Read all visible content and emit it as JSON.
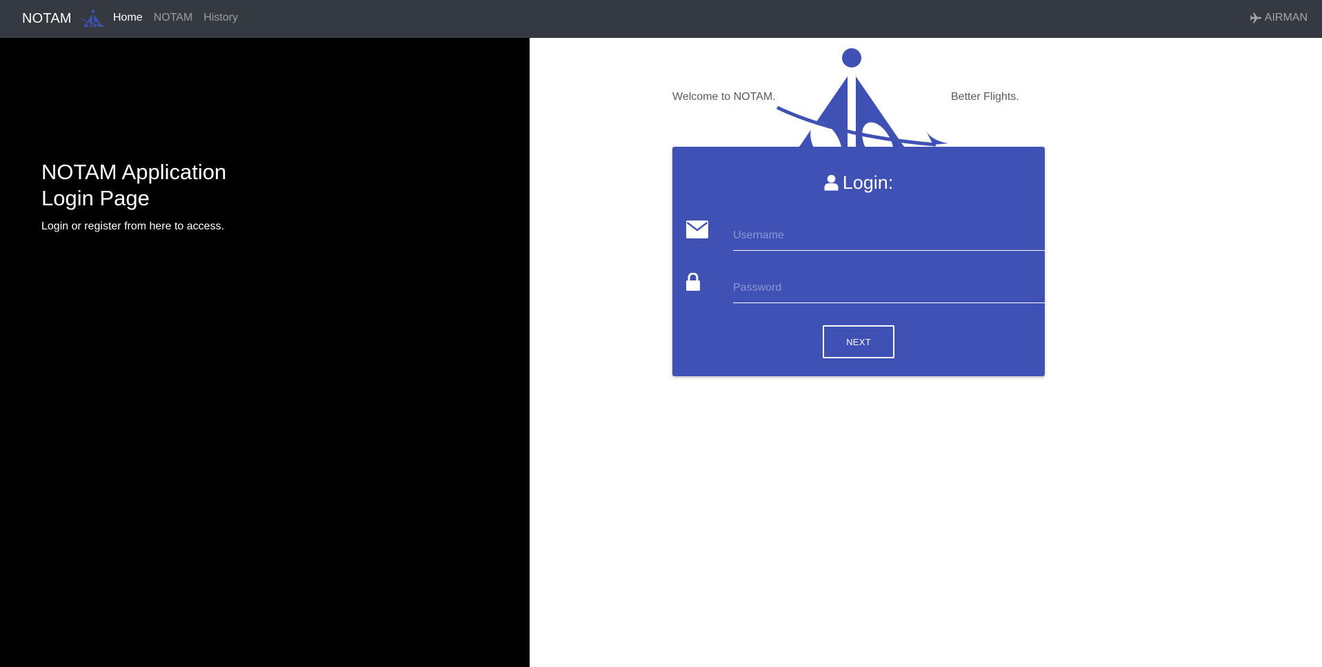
{
  "navbar": {
    "brand": "NOTAM",
    "logo_icon": "aai-logo-icon",
    "links": [
      {
        "label": "Home",
        "active": true
      },
      {
        "label": "NOTAM",
        "active": false
      },
      {
        "label": "History",
        "active": false
      }
    ],
    "user_icon": "plane-icon",
    "user_label": "AIRMAN"
  },
  "left_panel": {
    "title_line1": "NOTAM Application",
    "title_line2": "Login Page",
    "subtitle": "Login or register from here to access."
  },
  "hero": {
    "welcome": "Welcome to NOTAM.",
    "tagline": "Better Flights.",
    "logo_icon": "aai-logo-icon"
  },
  "login": {
    "heading": "Login:",
    "heading_icon": "user-icon",
    "username_icon": "envelope-icon",
    "username_placeholder": "Username",
    "username_value": "",
    "password_icon": "lock-icon",
    "password_placeholder": "Password",
    "password_value": "",
    "next_label": "NEXT"
  },
  "colors": {
    "navbar_bg": "#343a40",
    "accent": "#3f51b5",
    "left_panel_bg": "#000000",
    "page_bg": "#ffffff"
  }
}
